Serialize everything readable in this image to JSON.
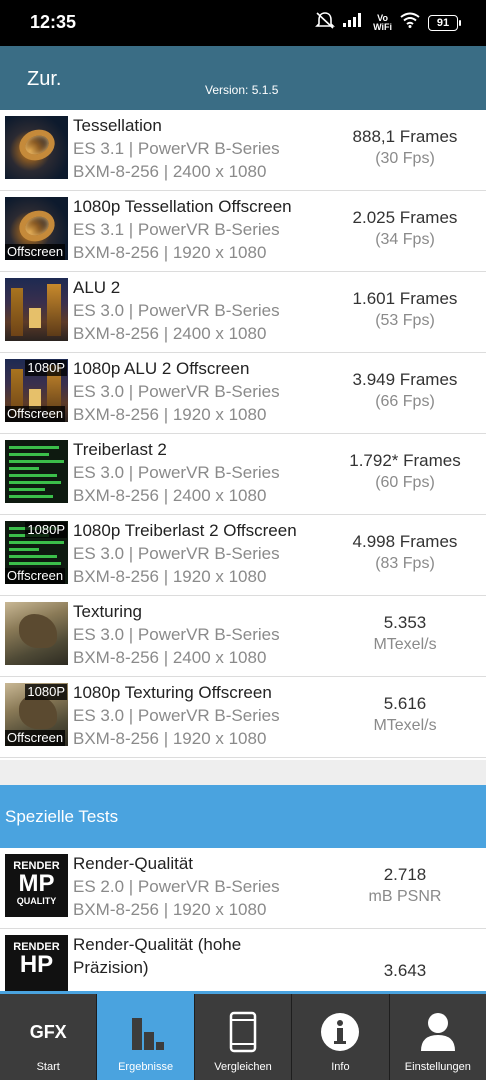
{
  "status_bar": {
    "time": "12:35",
    "vowifi_top": "Vo",
    "vowifi_bottom": "WiFi",
    "battery": "91"
  },
  "header": {
    "back_label": "Zur.",
    "version": "Version: 5.1.5"
  },
  "results": [
    {
      "title": "Tessellation",
      "api": "ES 3.1 | PowerVR B-Series",
      "device": "BXM-8-256 | 2400 x 1080",
      "score": "888,1 Frames",
      "score_sub": "(30 Fps)",
      "thumb": "tessellation"
    },
    {
      "title": "1080p Tessellation Offscreen",
      "api": "ES 3.1 | PowerVR B-Series",
      "device": "BXM-8-256 | 1920 x 1080",
      "score": "2.025 Frames",
      "score_sub": "(34 Fps)",
      "thumb": "tessellation",
      "tag_bottom": "Offscreen"
    },
    {
      "title": "ALU 2",
      "api": "ES 3.0 | PowerVR B-Series",
      "device": "BXM-8-256 | 2400 x 1080",
      "score": "1.601 Frames",
      "score_sub": "(53 Fps)",
      "thumb": "alu"
    },
    {
      "title": "1080p ALU 2 Offscreen",
      "api": "ES 3.0 | PowerVR B-Series",
      "device": "BXM-8-256 | 1920 x 1080",
      "score": "3.949 Frames",
      "score_sub": "(66 Fps)",
      "thumb": "alu",
      "tag_top": "1080P",
      "tag_bottom": "Offscreen"
    },
    {
      "title": "Treiberlast 2",
      "api": "ES 3.0 | PowerVR B-Series",
      "device": "BXM-8-256 | 2400 x 1080",
      "score": "1.792* Frames",
      "score_sub": "(60 Fps)",
      "thumb": "driver"
    },
    {
      "title": "1080p Treiberlast 2 Offscreen",
      "api": "ES 3.0 | PowerVR B-Series",
      "device": "BXM-8-256 | 1920 x 1080",
      "score": "4.998 Frames",
      "score_sub": "(83 Fps)",
      "thumb": "driver",
      "tag_top": "1080P",
      "tag_bottom": "Offscreen"
    },
    {
      "title": "Texturing",
      "api": "ES 3.0 | PowerVR B-Series",
      "device": "BXM-8-256 | 2400 x 1080",
      "score": "5.353",
      "score_sub": "MTexel/s",
      "thumb": "texturing"
    },
    {
      "title": "1080p Texturing Offscreen",
      "api": "ES 3.0 | PowerVR B-Series",
      "device": "BXM-8-256 | 1920 x 1080",
      "score": "5.616",
      "score_sub": "MTexel/s",
      "thumb": "texturing",
      "tag_top": "1080P",
      "tag_bottom": "Offscreen"
    }
  ],
  "special_section": {
    "title": "Spezielle Tests"
  },
  "special_results": [
    {
      "title": "Render-Qualität",
      "api": "ES 2.0 | PowerVR B-Series",
      "device": "BXM-8-256 | 1920 x 1080",
      "score": "2.718",
      "score_sub": "mB PSNR",
      "thumb_line1": "RENDER",
      "thumb_line2": "MP",
      "thumb_line3": "QUALITY"
    },
    {
      "title_line1": "Render-Qualität (hohe",
      "title_line2": "Präzision)",
      "score": "3.643",
      "thumb_line1": "RENDER",
      "thumb_line2": "HP"
    }
  ],
  "bottom_nav": [
    {
      "label": "Start",
      "icon": "gfx-logo-icon",
      "icon_text": "GFX"
    },
    {
      "label": "Ergebnisse",
      "icon": "bar-chart-icon",
      "active": true
    },
    {
      "label": "Vergleichen",
      "icon": "phone-icon"
    },
    {
      "label": "Info",
      "icon": "info-icon",
      "icon_text": "i"
    },
    {
      "label": "Einstellungen",
      "icon": "person-icon"
    }
  ],
  "colors": {
    "header_bg": "#3a6d85",
    "section_bg": "#4aa3df",
    "nav_bg": "#3c3c3c",
    "nav_active": "#4aa3df"
  }
}
